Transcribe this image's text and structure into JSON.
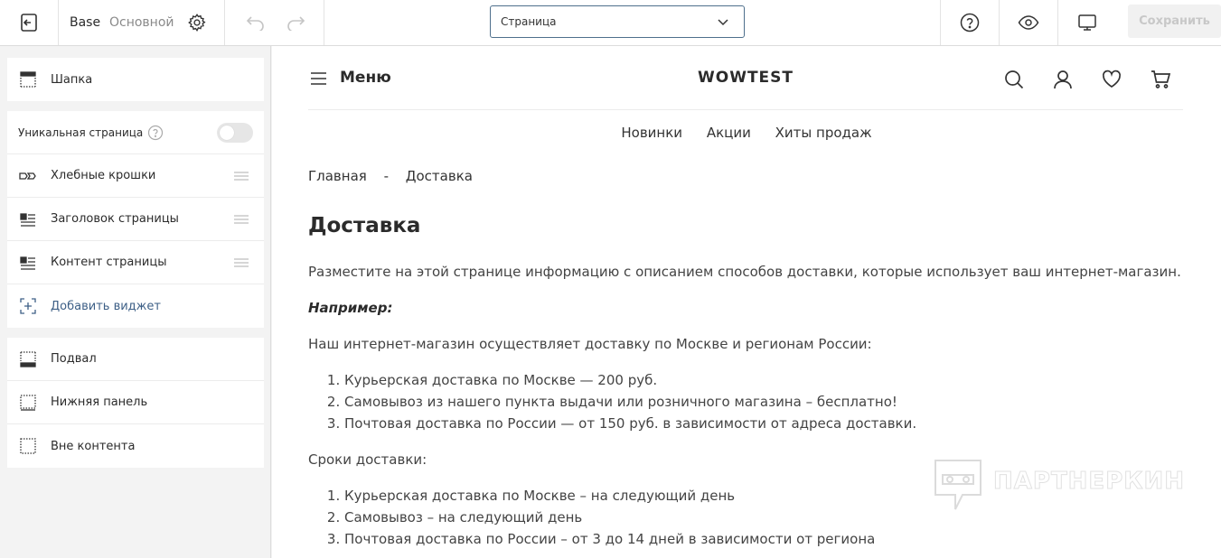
{
  "toolbar": {
    "theme_name": "Base",
    "theme_variant": "Основной",
    "page_select": "Страница",
    "save_label": "Сохранить"
  },
  "sidebar": {
    "header_item": "Шапка",
    "unique_page": "Уникальная страница",
    "unique_page_enabled": false,
    "widgets": [
      {
        "label": "Хлебные крошки",
        "icon": "breadcrumbs-icon"
      },
      {
        "label": "Заголовок страницы",
        "icon": "page-title-icon"
      },
      {
        "label": "Контент страницы",
        "icon": "page-content-icon"
      }
    ],
    "add_widget": "Добавить виджет",
    "bottom_items": [
      {
        "label": "Подвал",
        "icon": "footer-icon"
      },
      {
        "label": "Нижняя панель",
        "icon": "bottom-panel-icon"
      },
      {
        "label": "Вне контента",
        "icon": "outside-content-icon"
      }
    ]
  },
  "site": {
    "menu_label": "Меню",
    "logo": "WOWTEST",
    "nav": [
      "Новинки",
      "Акции",
      "Хиты продаж"
    ],
    "breadcrumbs": [
      "Главная",
      "-",
      "Доставка"
    ],
    "page_title": "Доставка",
    "intro": "Разместите на этой странице информацию с описанием способов доставки, которые использует ваш интернет-магазин.",
    "example": "Например:",
    "delivery_intro": "Наш интернет-магазин осуществляет доставку по Москве и регионам России:",
    "delivery_list": [
      "Курьерская доставка по Москве — 200 руб.",
      "Самовывоз из нашего пункта выдачи или розничного магазина – бесплатно!",
      "Почтовая доставка по России — от 150 руб. в зависимости от адреса доставки."
    ],
    "terms_intro": "Сроки доставки:",
    "terms_list": [
      "Курьерская доставка по Москве – на следующий день",
      "Самовывоз – на следующий день",
      "Почтовая доставка по России – от 3 до 14 дней в зависимости от региона"
    ]
  },
  "watermark": "ПАРТНЕРКИН"
}
